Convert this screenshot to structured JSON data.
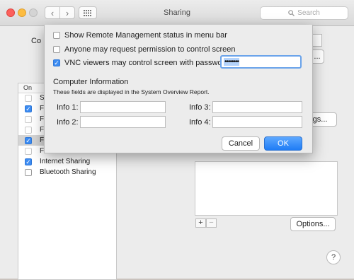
{
  "window": {
    "title": "Sharing",
    "search_placeholder": "Search"
  },
  "background": {
    "list_header_on": "On",
    "services": [
      {
        "label": "S",
        "checked": false
      },
      {
        "label": "F",
        "checked": true
      },
      {
        "label": "F",
        "checked": false
      },
      {
        "label": "F",
        "checked": false
      },
      {
        "label": "F",
        "checked": true
      },
      {
        "label": "F",
        "checked": false
      },
      {
        "label": "Internet Sharing",
        "checked": true
      },
      {
        "label": "Bluetooth Sharing",
        "checked": false
      }
    ],
    "partial_label_left": "Co",
    "partial_button_right": "ngs...",
    "partial_button_right_top": "...",
    "add": "+",
    "remove": "−",
    "options_button": "Options...",
    "help": "?"
  },
  "sheet": {
    "opt_show_status": "Show Remote Management status in menu bar",
    "opt_request_permission": "Anyone may request permission to control screen",
    "opt_vnc": "VNC viewers may control screen with password:",
    "password_value": "••••••••",
    "computer_info_title": "Computer Information",
    "computer_info_desc": "These fields are displayed in the System Overview Report.",
    "info1": "Info 1:",
    "info2": "Info 2:",
    "info3": "Info 3:",
    "info4": "Info 4:",
    "cancel": "Cancel",
    "ok": "OK",
    "checks": {
      "show_status": false,
      "request_permission": false,
      "vnc": true
    }
  },
  "colors": {
    "accent": "#1f7cf5",
    "checkbox_on": "#3d8cf2",
    "selection": "#b4d3fb"
  }
}
